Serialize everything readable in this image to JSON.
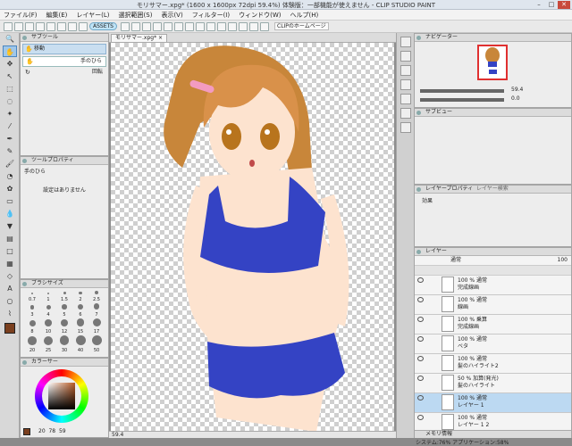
{
  "titlebar": {
    "title": "モリサマー.xpg* (1600 x 1600px 72dpi 59.4%) 体験版：一部機能が使えません - CLIP STUDIO PAINT",
    "min": "–",
    "max": "□",
    "close": "✕"
  },
  "menu": [
    "ファイル(F)",
    "編集(E)",
    "レイヤー(L)",
    "選択範囲(S)",
    "表示(V)",
    "フィルター(I)",
    "ウィンドウ(W)",
    "ヘルプ(H)"
  ],
  "commandbar": {
    "assets_pill": "ASSETS",
    "clip_link": "CLIPのホームページ"
  },
  "document": {
    "tab_label": "モリサマー.xpg*",
    "close": "×"
  },
  "subtool": {
    "title": "サブツール",
    "group": "移動",
    "items": [
      {
        "label": "手のひら"
      },
      {
        "label": "回転"
      }
    ]
  },
  "tool_property": {
    "title": "ツールプロパティ",
    "tool_name": "手のひら",
    "message": "設定はありません"
  },
  "brush_size": {
    "title": "ブラシサイズ",
    "sizes": [
      "0.7",
      "1",
      "1.5",
      "2",
      "2.5",
      "3",
      "4",
      "5",
      "6",
      "7",
      "8",
      "10",
      "12",
      "15",
      "17",
      "20",
      "25",
      "30",
      "40",
      "50"
    ]
  },
  "color": {
    "title": "カラーサー",
    "main_color": "#7a3f1e",
    "readout": [
      "20",
      "78",
      "59"
    ]
  },
  "navigator": {
    "title": "ナビゲーター",
    "zoom": "59.4",
    "angle": "0.0"
  },
  "subview": {
    "title": "サブビュー"
  },
  "layer_property": {
    "title": "レイヤープロパティ",
    "tab2": "レイヤー検索",
    "effect": "効果"
  },
  "layers": {
    "title": "レイヤー",
    "blend_mode": "通常",
    "opacity": "100",
    "rows": [
      {
        "line1": "100 % 通常",
        "line2": "完成線画",
        "selected": false
      },
      {
        "line1": "100 % 通常",
        "line2": "線画",
        "selected": false
      },
      {
        "line1": "100 % 乗算",
        "line2": "完成線画",
        "selected": false
      },
      {
        "line1": "100 % 通常",
        "line2": "ベタ",
        "selected": false
      },
      {
        "line1": "100 % 通常",
        "line2": "髪のハイライト2",
        "selected": false
      },
      {
        "line1": "50 % 加算(発光)",
        "line2": "髪のハイライト",
        "selected": false
      },
      {
        "line1": "100 % 通常",
        "line2": "レイヤー 1",
        "selected": true
      },
      {
        "line1": "100 % 通常",
        "line2": "レイヤー 1 2",
        "selected": false
      }
    ]
  },
  "statusbar": {
    "zoom": "59.4",
    "memory_title": "メモリ情報",
    "memory": "システム:76%  アプリケーション:58%"
  },
  "colors": {
    "accent": "#4a86c0",
    "selected_row": "#bcd9f2"
  }
}
